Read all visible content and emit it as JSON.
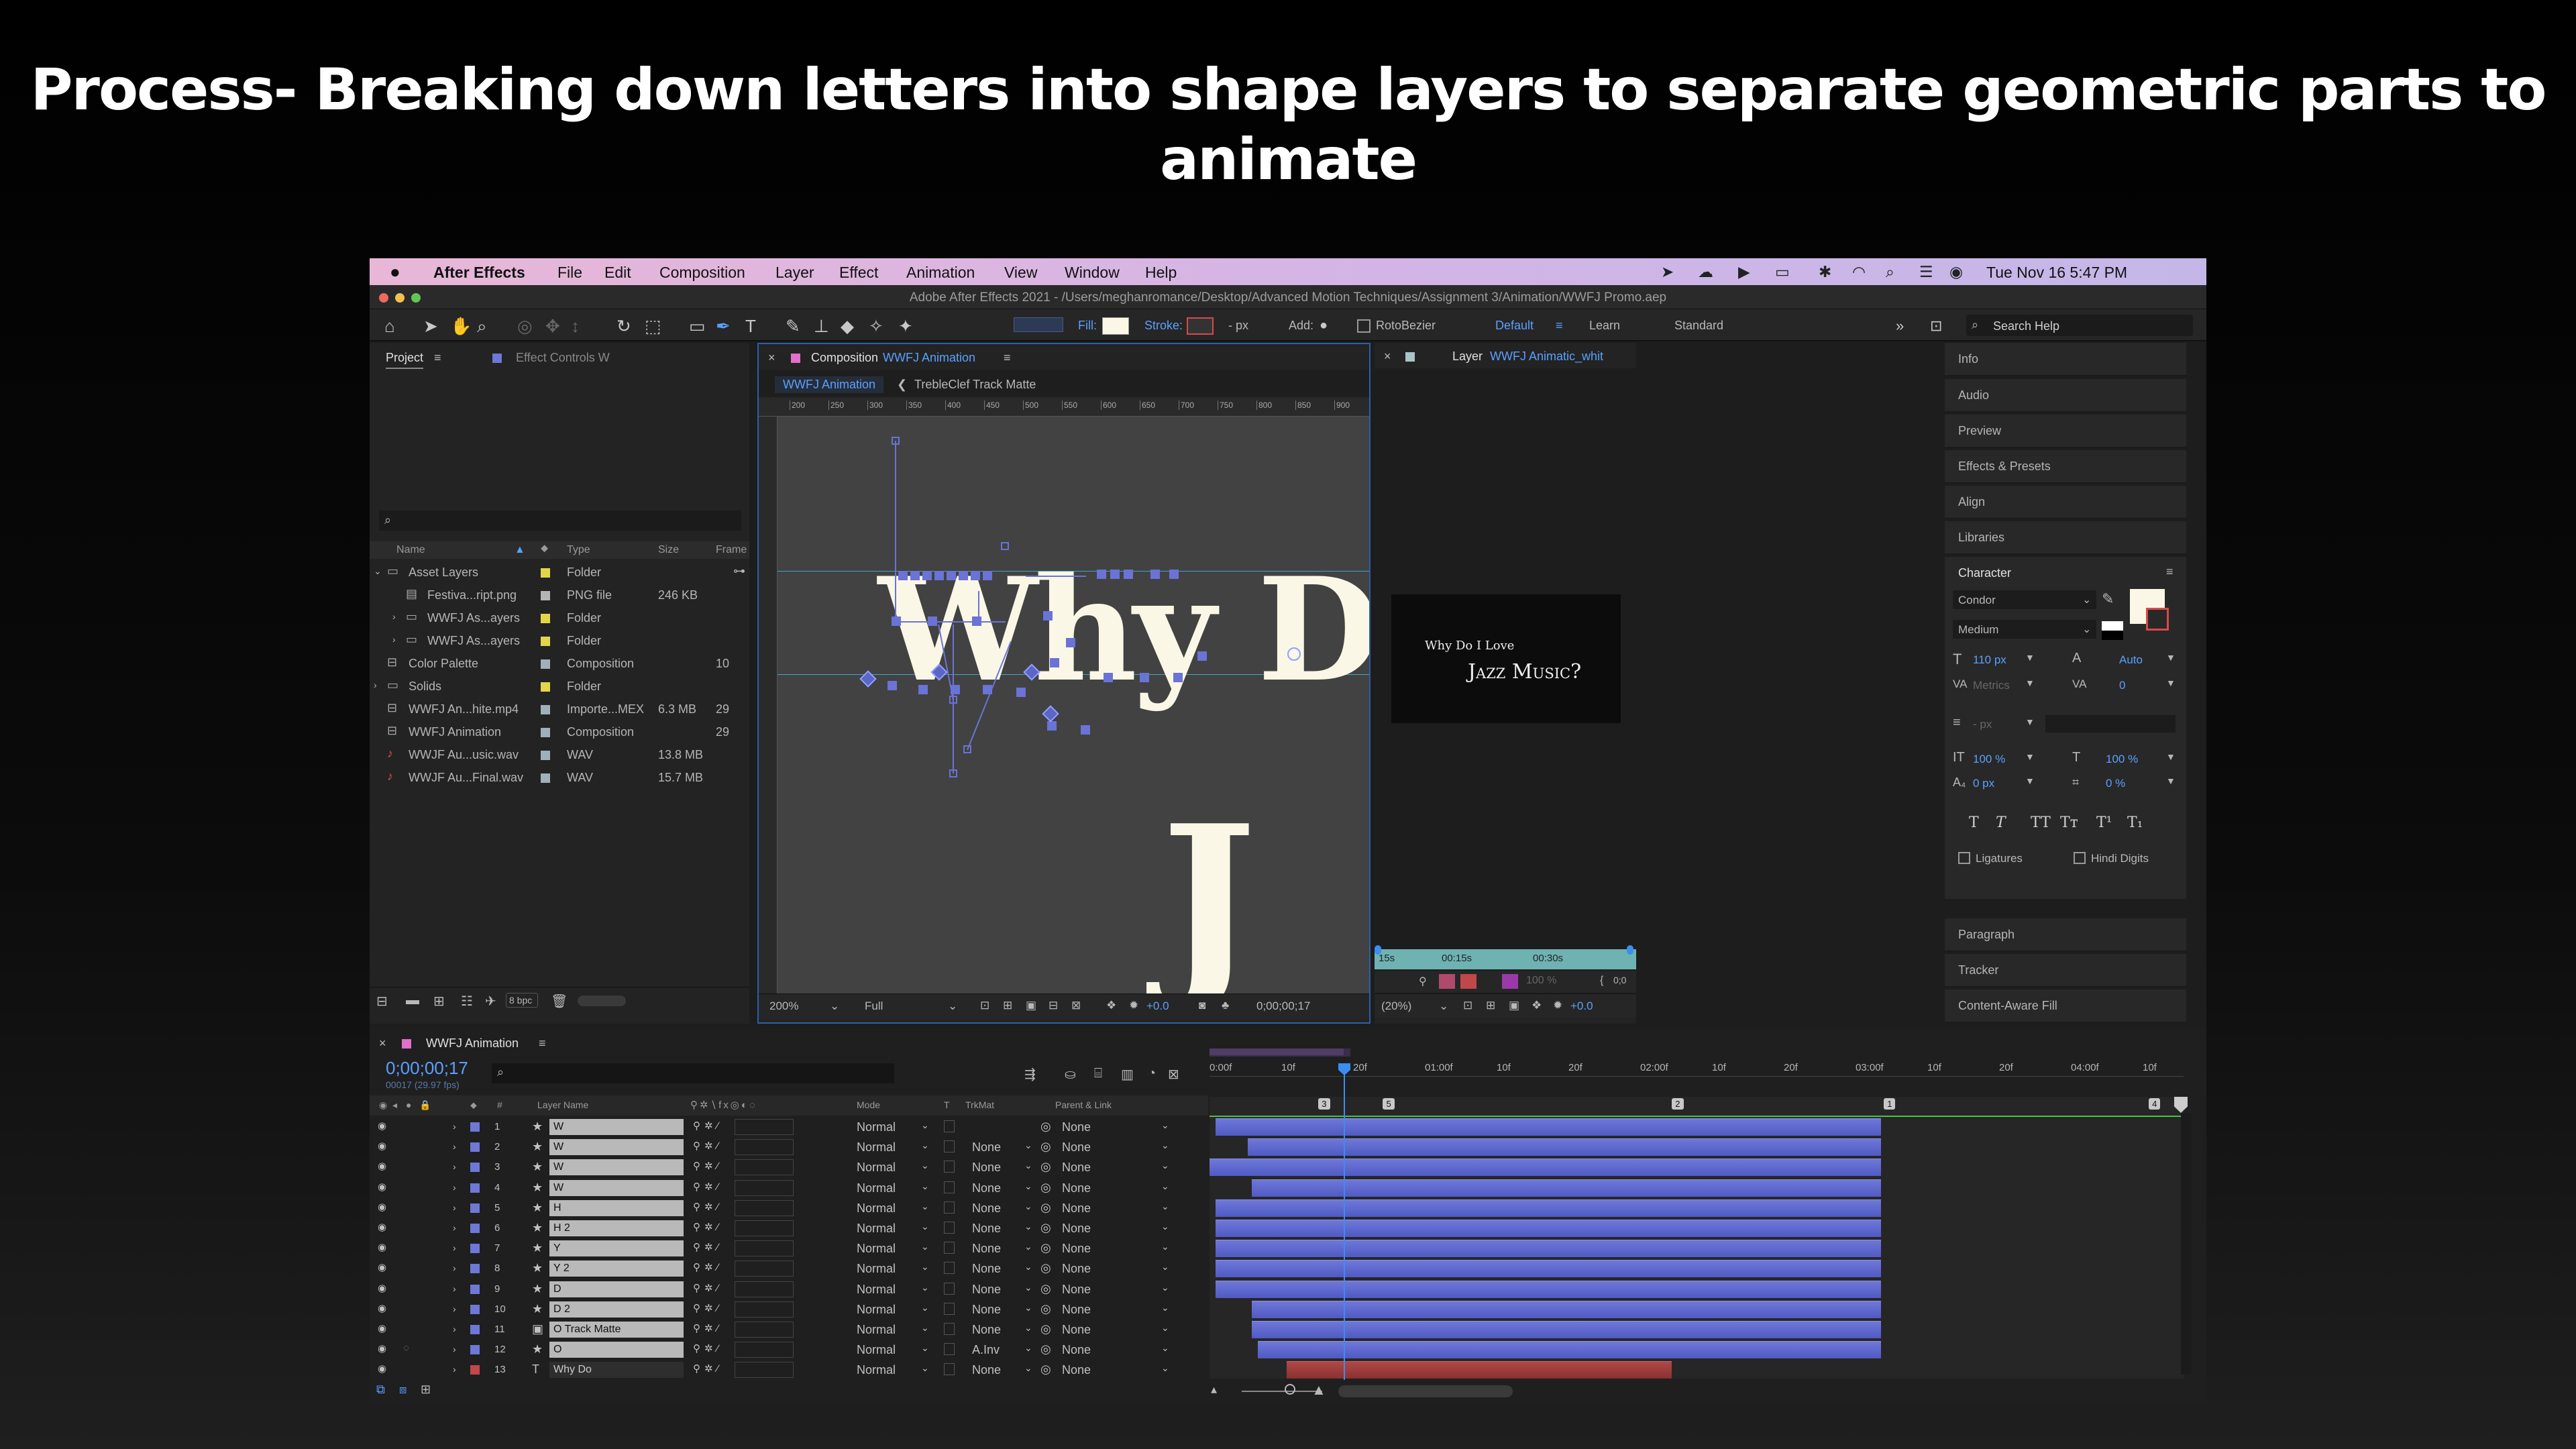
{
  "slide": {
    "title": "Process- Breaking down letters into shape layers to separate geometric parts to animate"
  },
  "menubar": {
    "app": "After Effects",
    "items": [
      "File",
      "Edit",
      "Composition",
      "Layer",
      "Effect",
      "Animation",
      "View",
      "Window",
      "Help"
    ],
    "clock": "Tue Nov 16  5:47 PM"
  },
  "window": {
    "title": "Adobe After Effects 2021 - /Users/meghanromance/Desktop/Advanced Motion Techniques/Assignment 3/Animation/WWFJ Promo.aep"
  },
  "toolbar": {
    "fill_label": "Fill:",
    "stroke_label": "Stroke:",
    "stroke_px": "- px",
    "add_label": "Add:",
    "rotobezier": "RotoBezier",
    "workspace_default": "Default",
    "workspace_learn": "Learn",
    "workspace_standard": "Standard",
    "search_placeholder": "Search Help"
  },
  "project": {
    "tab": "Project",
    "tab2": "Effect Controls W",
    "columns": {
      "name": "Name",
      "type": "Type",
      "size": "Size",
      "frame": "Frame"
    },
    "items": [
      {
        "name": "Asset Layers",
        "type": "Folder",
        "size": "",
        "frame": "",
        "color": "#e3d54a"
      },
      {
        "name": "Festiva...ript.png",
        "type": "PNG file",
        "size": "246 KB",
        "frame": "",
        "color": "#b5b5b5"
      },
      {
        "name": "WWFJ As...ayers",
        "type": "Folder",
        "size": "",
        "frame": "",
        "color": "#e3d54a"
      },
      {
        "name": "WWFJ As...ayers",
        "type": "Folder",
        "size": "",
        "frame": "",
        "color": "#e3d54a"
      },
      {
        "name": "Color Palette",
        "type": "Composition",
        "size": "",
        "frame": "10",
        "color": "#9fb0b8"
      },
      {
        "name": "Solids",
        "type": "Folder",
        "size": "",
        "frame": "",
        "color": "#e3d54a"
      },
      {
        "name": "WWFJ An...hite.mp4",
        "type": "Importe...MEX",
        "size": "6.3 MB",
        "frame": "29",
        "color": "#9fb0b8"
      },
      {
        "name": "WWFJ Animation",
        "type": "Composition",
        "size": "",
        "frame": "29",
        "color": "#9fb0b8"
      },
      {
        "name": "WWJF Au...usic.wav",
        "type": "WAV",
        "size": "13.8 MB",
        "frame": "",
        "color": "#9fb0b8"
      },
      {
        "name": "WWJF Au...Final.wav",
        "type": "WAV",
        "size": "15.7 MB",
        "frame": "",
        "color": "#9fb0b8"
      }
    ],
    "bpc": "8 bpc"
  },
  "comp": {
    "tab_prefix": "Composition",
    "tab_name": "WWFJ Animation",
    "sub_tab1": "WWFJ Animation",
    "sub_tab2": "TrebleClef Track Matte",
    "ruler": [
      "200",
      "250",
      "300",
      "350",
      "400",
      "450",
      "500",
      "550",
      "600",
      "650",
      "700",
      "750",
      "800",
      "850",
      "900"
    ],
    "text_main": "Why Do I Lov",
    "text_j": "J",
    "zoom": "200%",
    "res": "Full",
    "exposure": "+0.0",
    "timecode": "0;00;00;17"
  },
  "layerviewer": {
    "tab_prefix": "Layer",
    "tab_name": "WWFJ Animatic_whit",
    "preview_line1": "Why Do I Love",
    "preview_line2": "Jazz Music?",
    "time_a": "15s",
    "time_b": "00:15s",
    "time_c": "00:30s",
    "zoom": "(20%)",
    "exposure": "+0.0",
    "opacity": "100 %",
    "tc_short": "0;0"
  },
  "panels": {
    "collapsed": [
      "Info",
      "Audio",
      "Preview",
      "Effects & Presets",
      "Align",
      "Libraries"
    ],
    "bottom": [
      "Paragraph",
      "Tracker",
      "Content-Aware Fill"
    ]
  },
  "character": {
    "title": "Character",
    "font": "Condor",
    "style": "Medium",
    "size": "110 px",
    "leading": "Auto",
    "kerning": "Metrics",
    "tracking": "0",
    "stroke_px": "- px",
    "vscale": "100 %",
    "hscale": "100 %",
    "baseline": "0 px",
    "tsume": "0 %",
    "ligatures": "Ligatures",
    "hindi": "Hindi Digits",
    "styles": [
      "T",
      "T",
      "TT",
      "Tт",
      "T¹",
      "T₁"
    ],
    "fill_color": "#fbf7e6",
    "stroke_color": "#d64a4a"
  },
  "timeline": {
    "tab": "WWFJ Animation",
    "timecode": "0;00;00;17",
    "frames": "00017 (29.97 fps)",
    "cols": {
      "num": "#",
      "name": "Layer Name",
      "mode": "Mode",
      "t": "T",
      "trkmat": "TrkMat",
      "parent": "Parent & Link"
    },
    "ruler": [
      "0:00f",
      "10f",
      "20f",
      "01:00f",
      "10f",
      "20f",
      "02:00f",
      "10f",
      "20f",
      "03:00f",
      "10f",
      "20f",
      "04:00f",
      "10f"
    ],
    "markers": [
      "3",
      "5",
      "2",
      "1",
      "4"
    ],
    "layers": [
      {
        "num": "1",
        "name": "W",
        "mode": "Normal",
        "trk": "",
        "parent": "None",
        "start": 0.006,
        "end": 0.697,
        "color": "#6e78d6",
        "icon": "★"
      },
      {
        "num": "2",
        "name": "W",
        "mode": "Normal",
        "trk": "None",
        "parent": "None",
        "start": 0.04,
        "end": 0.697,
        "color": "#6e78d6",
        "icon": "★"
      },
      {
        "num": "3",
        "name": "W",
        "mode": "Normal",
        "trk": "None",
        "parent": "None",
        "start": 0.0,
        "end": 0.697,
        "color": "#6e78d6",
        "icon": "★"
      },
      {
        "num": "4",
        "name": "W",
        "mode": "Normal",
        "trk": "None",
        "parent": "None",
        "start": 0.044,
        "end": 0.697,
        "color": "#6e78d6",
        "icon": "★"
      },
      {
        "num": "5",
        "name": "H",
        "mode": "Normal",
        "trk": "None",
        "parent": "None",
        "start": 0.006,
        "end": 0.697,
        "color": "#6e78d6",
        "icon": "★"
      },
      {
        "num": "6",
        "name": "H 2",
        "mode": "Normal",
        "trk": "None",
        "parent": "None",
        "start": 0.006,
        "end": 0.697,
        "color": "#6e78d6",
        "icon": "★"
      },
      {
        "num": "7",
        "name": "Y",
        "mode": "Normal",
        "trk": "None",
        "parent": "None",
        "start": 0.006,
        "end": 0.697,
        "color": "#6e78d6",
        "icon": "★"
      },
      {
        "num": "8",
        "name": "Y 2",
        "mode": "Normal",
        "trk": "None",
        "parent": "None",
        "start": 0.006,
        "end": 0.697,
        "color": "#6e78d6",
        "icon": "★"
      },
      {
        "num": "9",
        "name": "D",
        "mode": "Normal",
        "trk": "None",
        "parent": "None",
        "start": 0.006,
        "end": 0.697,
        "color": "#6e78d6",
        "icon": "★"
      },
      {
        "num": "10",
        "name": "D 2",
        "mode": "Normal",
        "trk": "None",
        "parent": "None",
        "start": 0.044,
        "end": 0.697,
        "color": "#6e78d6",
        "icon": "★"
      },
      {
        "num": "11",
        "name": "O Track Matte",
        "mode": "Normal",
        "trk": "None",
        "parent": "None",
        "start": 0.044,
        "end": 0.697,
        "color": "#6e78d6",
        "icon": "▣"
      },
      {
        "num": "12",
        "name": "O",
        "mode": "Normal",
        "trk": "A.Inv",
        "parent": "None",
        "start": 0.05,
        "end": 0.697,
        "color": "#6e78d6",
        "icon": "★"
      },
      {
        "num": "13",
        "name": "Why Do",
        "mode": "Normal",
        "trk": "None",
        "parent": "None",
        "start": 0.08,
        "end": 0.48,
        "color": "#c04848",
        "icon": "T"
      }
    ]
  }
}
